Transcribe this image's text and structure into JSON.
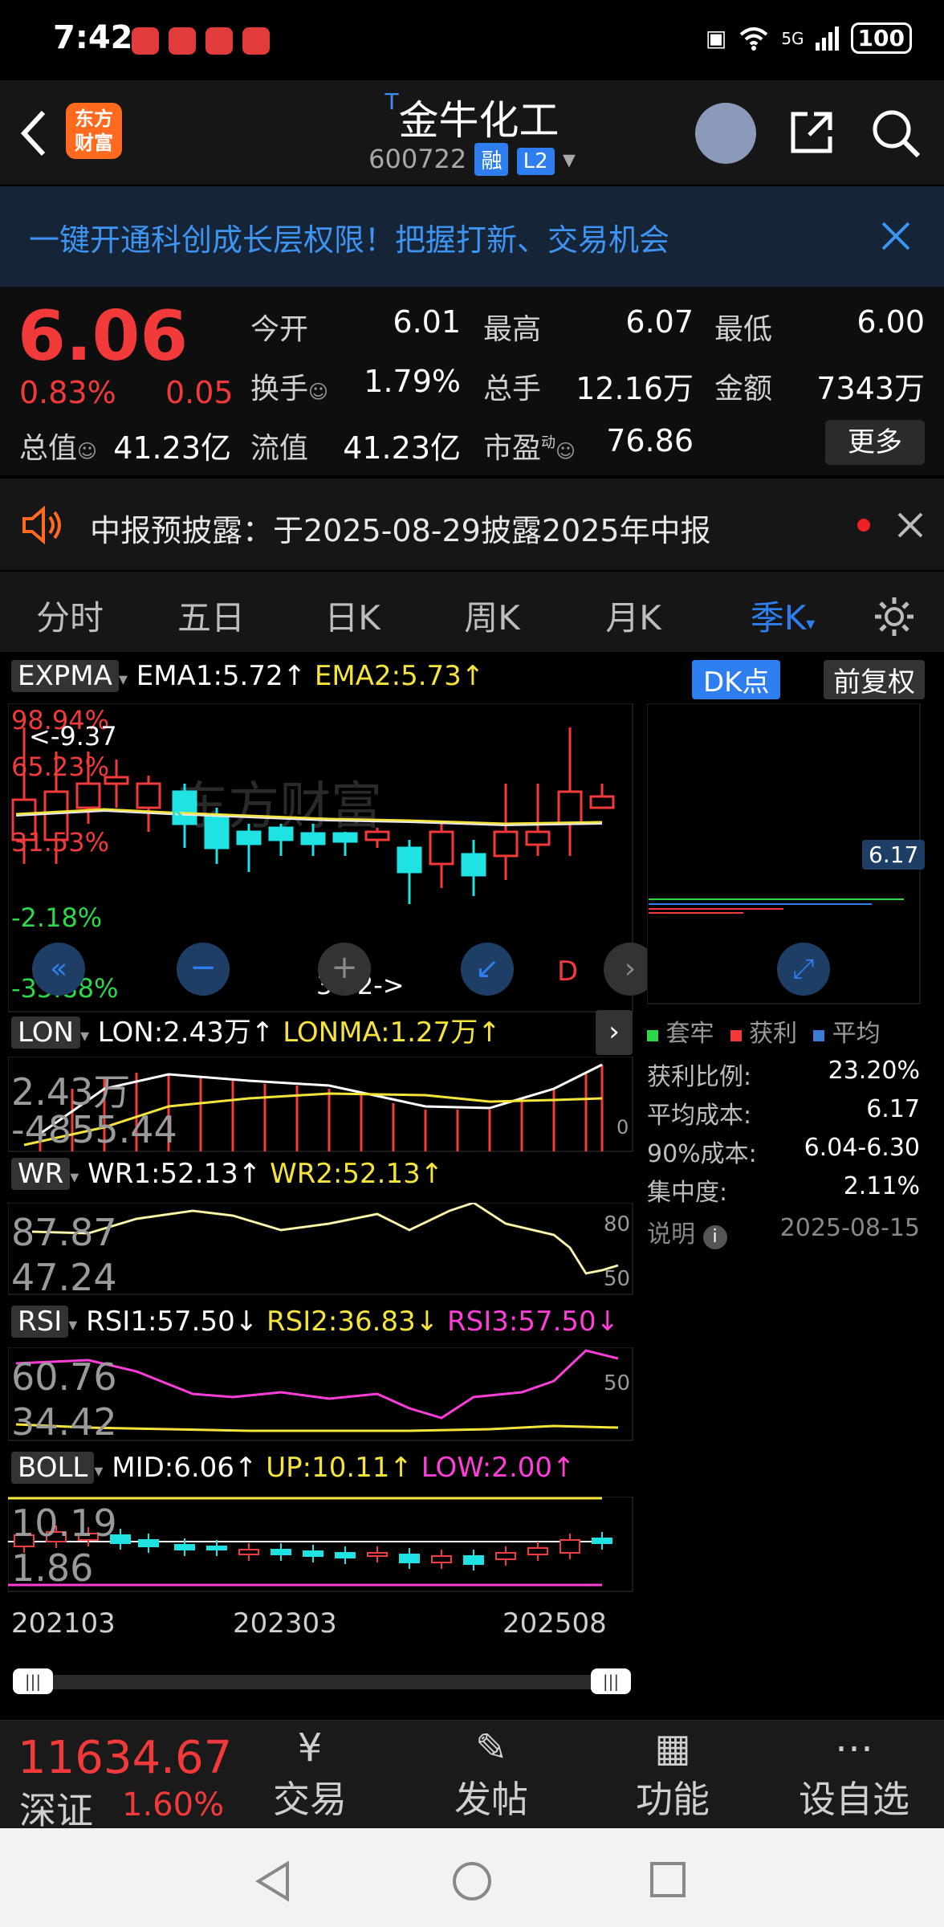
{
  "status_bar": {
    "time": "7:42",
    "battery": "100",
    "network": "5G"
  },
  "header": {
    "logo_text_1": "东方",
    "logo_text_2": "财富",
    "title_prefix": "T",
    "title": "金牛化工",
    "code": "600722",
    "tag_rong": "融",
    "tag_l2": "L2"
  },
  "banner": {
    "text": "一键开通科创成长层权限！把握打新、交易机会"
  },
  "quote": {
    "price": "6.06",
    "change_pct": "0.83%",
    "change_amt": "0.05",
    "open_label": "今开",
    "open": "6.01",
    "high_label": "最高",
    "high": "6.07",
    "low_label": "最低",
    "low": "6.00",
    "turnover_label": "换手",
    "turnover": "1.79%",
    "volume_label": "总手",
    "volume": "12.16万",
    "amount_label": "金额",
    "amount": "7343万",
    "mktcap_label": "总值",
    "mktcap": "41.23亿",
    "float_label": "流值",
    "float_cap": "41.23亿",
    "pe_label": "市盈",
    "pe_sup": "动",
    "pe": "76.86",
    "more_label": "更多"
  },
  "notice": {
    "text": "中报预披露：于2025-08-29披露2025年中报"
  },
  "tabs": [
    "分时",
    "五日",
    "日K",
    "周K",
    "月K",
    "季K"
  ],
  "main_chart": {
    "indicator": "EXPMA",
    "ema1": "EMA1:5.72",
    "ema2": "EMA2:5.73",
    "dk_button": "DK点",
    "adjust_button": "前复权",
    "y_labels": [
      "98.94%",
      "65.23%",
      "31.53%",
      "-2.18%",
      "-35.88%"
    ],
    "annotation_max": "<-9.37",
    "annotation_min": "3.02->",
    "k_label": "K",
    "d_label": "D",
    "watermark": "东方财富"
  },
  "chip_panel": {
    "price_tag": "6.17",
    "legend": [
      "套牢",
      "获利",
      "平均"
    ],
    "legend_colors": [
      "#2dd84a",
      "#f23a3a",
      "#3a7bd5"
    ],
    "rows": [
      {
        "label": "获利比例:",
        "value": "23.20%"
      },
      {
        "label": "平均成本:",
        "value": "6.17"
      },
      {
        "label": "90%成本:",
        "value": "6.04-6.30"
      },
      {
        "label": "集中度:",
        "value": "2.11%"
      }
    ],
    "note_label": "说明",
    "date": "2025-08-15"
  },
  "lon": {
    "name": "LON",
    "lon": "LON:2.43万",
    "lonma": "LONMA:1.27万",
    "y_top": "2.43万",
    "y_bottom": "-4855.44",
    "zero": "0"
  },
  "wr": {
    "name": "WR",
    "wr1": "WR1:52.13",
    "wr2": "WR2:52.13",
    "y_top": "87.87",
    "y_bottom": "47.24",
    "ref_80": "80",
    "ref_50": "50"
  },
  "rsi": {
    "name": "RSI",
    "rsi1": "RSI1:57.50",
    "rsi2": "RSI2:36.83",
    "rsi3": "RSI3:57.50",
    "y_top": "60.76",
    "y_bottom": "34.42",
    "ref_50": "50"
  },
  "boll": {
    "name": "BOLL",
    "mid": "MID:6.06",
    "up": "UP:10.11",
    "low": "LOW:2.00",
    "y_top": "10.19",
    "y_bottom": "1.86"
  },
  "x_axis": [
    "202103",
    "202303",
    "202508"
  ],
  "bottom_bar": {
    "index_value": "11634.67",
    "index_name": "深证",
    "index_change": "1.60%",
    "items": [
      "交易",
      "发帖",
      "功能",
      "设自选"
    ]
  },
  "colors": {
    "up": "#f23a3a",
    "down": "#1fe3e3",
    "accent": "#2f7ef0"
  }
}
